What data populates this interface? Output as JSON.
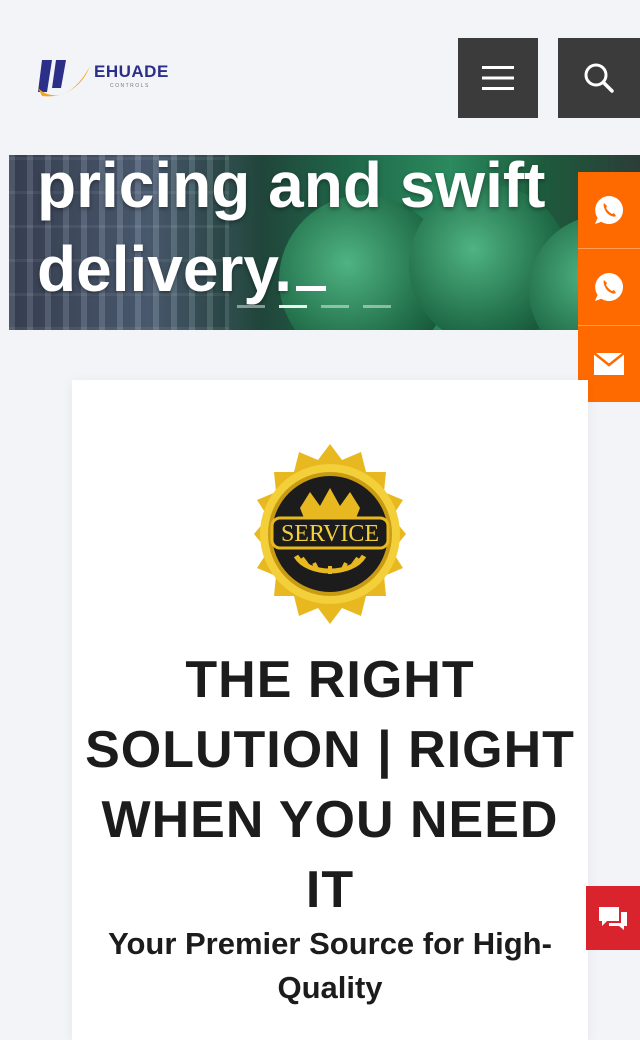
{
  "header": {
    "logo_text": "EHUADE",
    "logo_subtext": "CONTROLS",
    "menu_icon": "hamburger-menu-icon",
    "search_icon": "search-icon",
    "button_color": "#3b3b3b"
  },
  "hero": {
    "line1": "pricing and swift",
    "line2": "delivery.",
    "slides": [
      {
        "active": false
      },
      {
        "active": true
      },
      {
        "active": false
      },
      {
        "active": false
      }
    ]
  },
  "side_contact": {
    "color": "#ff6a00",
    "items": [
      {
        "icon": "whatsapp-icon"
      },
      {
        "icon": "whatsapp-icon"
      },
      {
        "icon": "email-icon"
      }
    ]
  },
  "card": {
    "badge_text": "SERVICE",
    "title": "THE RIGHT SOLUTION | RIGHT WHEN YOU NEED IT",
    "subtitle": "Your Premier Source for High-Quality"
  },
  "chat": {
    "icon": "chat-icon",
    "color": "#d9232d"
  }
}
